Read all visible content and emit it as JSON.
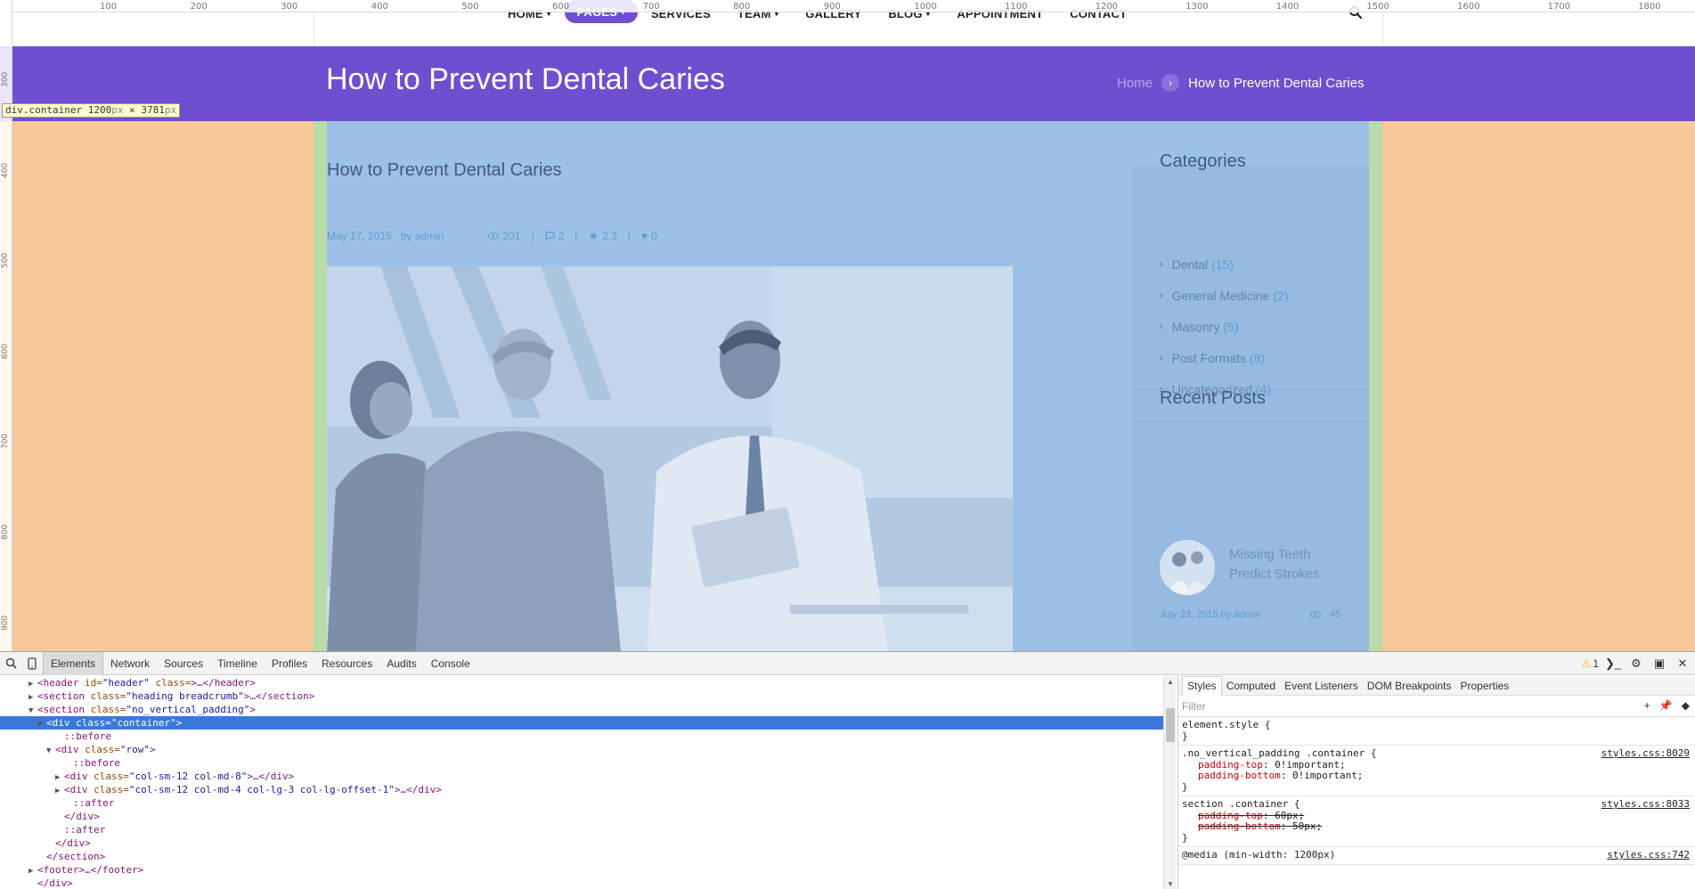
{
  "ruler": {
    "top_ticks": [
      "100",
      "200",
      "300",
      "400",
      "500",
      "600",
      "700",
      "800",
      "900",
      "1000",
      "1100",
      "1200",
      "1300",
      "1400",
      "1500",
      "1600",
      "1700",
      "1800"
    ],
    "left_ticks": [
      "300",
      "400",
      "500",
      "600",
      "700",
      "800",
      "900"
    ]
  },
  "nav": {
    "items": [
      {
        "label": "HOME",
        "caret": "▾"
      },
      {
        "label": "PAGES",
        "caret": "▾"
      },
      {
        "label": "SERVICES",
        "caret": ""
      },
      {
        "label": "TEAM",
        "caret": "▾"
      },
      {
        "label": "GALLERY",
        "caret": ""
      },
      {
        "label": "BLOG",
        "caret": "▾"
      },
      {
        "label": "APPOINTMENT",
        "caret": ""
      },
      {
        "label": "CONTACT",
        "caret": ""
      }
    ],
    "search_icon": "search-icon"
  },
  "heading": {
    "title": "How to Prevent Dental Caries",
    "breadcrumb_home": "Home",
    "breadcrumb_sep": "›",
    "breadcrumb_current": "How to Prevent Dental Caries"
  },
  "inspector_tooltip": {
    "selector": "div.container",
    "width": "1200",
    "width_unit": "px",
    "times": "×",
    "height": "3781",
    "height_unit": "px"
  },
  "post": {
    "title": "How to Prevent Dental Caries",
    "date": "May 17, 2015",
    "by": "by",
    "author": "admin",
    "views": "201",
    "comments": "2",
    "rating": "2.3",
    "likes": "0",
    "separator": "|"
  },
  "sidebar": {
    "categories_title": "Categories",
    "categories": [
      {
        "name": "Dental",
        "count": "(15)"
      },
      {
        "name": "General Medicine",
        "count": "(2)"
      },
      {
        "name": "Masonry",
        "count": "(5)"
      },
      {
        "name": "Post Formats",
        "count": "(8)"
      },
      {
        "name": "Uncategorized",
        "count": "(4)"
      }
    ],
    "recent_title": "Recent Posts",
    "recent_post": {
      "title": "Missing Teeth Predict Strokes",
      "date": "July 23, 2015",
      "by": "by",
      "author": "admin",
      "views": "45"
    }
  },
  "devtools": {
    "tabs": [
      "Elements",
      "Network",
      "Sources",
      "Timeline",
      "Profiles",
      "Resources",
      "Audits",
      "Console"
    ],
    "active_tab": "Elements",
    "warning_count": "1",
    "dom": [
      {
        "indent": 3,
        "tri": "▶",
        "open": "<header",
        "attr": " id=",
        "val": "\"header\"",
        "attr2": " class=",
        "val2": "",
        "close": ">…</header>",
        "sel": false
      },
      {
        "indent": 3,
        "tri": "▶",
        "open": "<section",
        "attr": " class=",
        "val": "\"heading breadcrumb\"",
        "attr2": "",
        "val2": "",
        "close": ">…</section>",
        "sel": false
      },
      {
        "indent": 3,
        "tri": "▼",
        "open": "<section",
        "attr": " class=",
        "val": "\"no_vertical_padding\"",
        "attr2": "",
        "val2": "",
        "close": ">",
        "sel": false
      },
      {
        "indent": 4,
        "tri": "▼",
        "open": "<div",
        "attr": " class=",
        "val": "\"container\"",
        "attr2": "",
        "val2": "",
        "close": ">",
        "sel": true
      },
      {
        "indent": 6,
        "tri": "",
        "open": "::before",
        "attr": "",
        "val": "",
        "attr2": "",
        "val2": "",
        "close": "",
        "sel": false
      },
      {
        "indent": 5,
        "tri": "▼",
        "open": "<div",
        "attr": " class=",
        "val": "\"row\"",
        "attr2": "",
        "val2": "",
        "close": ">",
        "sel": false
      },
      {
        "indent": 7,
        "tri": "",
        "open": "::before",
        "attr": "",
        "val": "",
        "attr2": "",
        "val2": "",
        "close": "",
        "sel": false
      },
      {
        "indent": 6,
        "tri": "▶",
        "open": "<div",
        "attr": " class=",
        "val": "\"col-sm-12 col-md-8\"",
        "attr2": "",
        "val2": "",
        "close": ">…</div>",
        "sel": false
      },
      {
        "indent": 6,
        "tri": "▶",
        "open": "<div",
        "attr": " class=",
        "val": "\"col-sm-12 col-md-4 col-lg-3 col-lg-offset-1\"",
        "attr2": "",
        "val2": "",
        "close": ">…</div>",
        "sel": false
      },
      {
        "indent": 7,
        "tri": "",
        "open": "::after",
        "attr": "",
        "val": "",
        "attr2": "",
        "val2": "",
        "close": "",
        "sel": false
      },
      {
        "indent": 6,
        "tri": "",
        "open": "</div>",
        "attr": "",
        "val": "",
        "attr2": "",
        "val2": "",
        "close": "",
        "sel": false
      },
      {
        "indent": 6,
        "tri": "",
        "open": "::after",
        "attr": "",
        "val": "",
        "attr2": "",
        "val2": "",
        "close": "",
        "sel": false
      },
      {
        "indent": 5,
        "tri": "",
        "open": "</div>",
        "attr": "",
        "val": "",
        "attr2": "",
        "val2": "",
        "close": "",
        "sel": false
      },
      {
        "indent": 4,
        "tri": "",
        "open": "</section>",
        "attr": "",
        "val": "",
        "attr2": "",
        "val2": "",
        "close": "",
        "sel": false
      },
      {
        "indent": 3,
        "tri": "▶",
        "open": "<footer",
        "attr": "",
        "val": "",
        "attr2": "",
        "val2": "",
        "close": ">…</footer>",
        "sel": false
      },
      {
        "indent": 3,
        "tri": "",
        "open": "</div>",
        "attr": "",
        "val": "",
        "attr2": "",
        "val2": "",
        "close": "",
        "sel": false
      }
    ],
    "styles_tabs": [
      "Styles",
      "Computed",
      "Event Listeners",
      "DOM Breakpoints",
      "Properties"
    ],
    "filter_placeholder": "Filter",
    "rules": [
      {
        "selector": "element.style {",
        "source": "",
        "props": [],
        "end": "}"
      },
      {
        "selector": ".no_vertical_padding .container {",
        "source": "styles.css:8029",
        "props": [
          {
            "name": "padding-top",
            "value": ": 0!important;",
            "struck": false
          },
          {
            "name": "padding-bottom",
            "value": ": 0!important;",
            "struck": false
          }
        ],
        "end": "}"
      },
      {
        "selector": "section .container {",
        "source": "styles.css:8033",
        "props": [
          {
            "name": "padding-top",
            "value": ": 60px;",
            "struck": true
          },
          {
            "name": "padding-bottom",
            "value": ": 50px;",
            "struck": true
          }
        ],
        "end": "}"
      },
      {
        "selector": "@media (min-width: 1200px)",
        "source": "styles.css:742",
        "props": [],
        "end": ""
      }
    ]
  },
  "colors": {
    "brand_purple": "#6f4fcf",
    "overlay_content": "#9dc1e6",
    "overlay_padding": "#b9dba8",
    "overlay_margin": "#f6c89a",
    "selection": "#3879d9"
  }
}
